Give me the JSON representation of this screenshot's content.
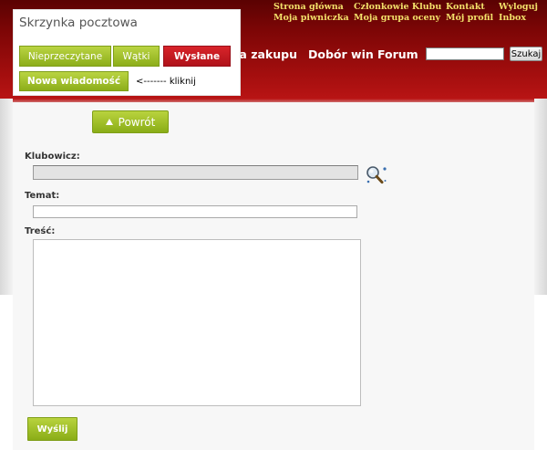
{
  "top_links": {
    "col1": [
      "Strona główna",
      "Moja piwniczka"
    ],
    "col2": [
      "Członkowie Klubu",
      "Moja grupa oceny"
    ],
    "col3": [
      "Kontakt",
      "Mój profil"
    ],
    "col4": [
      "Wyloguj",
      "Inbox"
    ]
  },
  "main_nav": {
    "item_zakupu": "ca zakupu",
    "item_dobor": "Dobór win",
    "item_forum": "Forum"
  },
  "search": {
    "value": "",
    "button_label": "Szukaj"
  },
  "mailbox": {
    "title": "Skrzynka pocztowa",
    "tabs": [
      "Nieprzeczytane",
      "Wątki",
      "Wysłane"
    ],
    "active_tab": "Wysłane",
    "new_message_label": "Nowa wiadomość",
    "hint": "<------- kliknij"
  },
  "form": {
    "back_label": "Powrót",
    "recipient_label": "Klubowicz:",
    "recipient_value": "",
    "subject_label": "Temat:",
    "subject_value": "",
    "body_label": "Treść:",
    "body_value": "",
    "send_label": "Wyślij"
  },
  "colors": {
    "header_red": "#a30e0e",
    "top_link_yellow": "#f2e06a",
    "tab_green": "#8cae1a",
    "tab_active_red": "#b0121a"
  },
  "icons": {
    "recipient_lookup": "magnifier-search-icon",
    "back": "triangle-up-icon"
  }
}
